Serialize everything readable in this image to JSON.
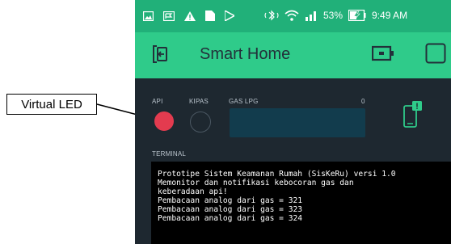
{
  "annotation": {
    "callout_label": "Virtual LED"
  },
  "status_bar": {
    "battery_percent": "53%",
    "time": "9:49 AM"
  },
  "header": {
    "title": "Smart Home"
  },
  "widgets": {
    "led_api": {
      "label": "API",
      "color": "#e33b4f",
      "state": "on"
    },
    "led_kipas": {
      "label": "KIPAS",
      "color": "#1e2830",
      "state": "off"
    },
    "gauge_gas": {
      "label": "GAS LPG",
      "value": "0",
      "color": "#123c4d"
    }
  },
  "terminal": {
    "label": "TERMINAL",
    "lines": [
      "Prototipe Sistem Keamanan Rumah (SisKeRu) versi 1.0",
      "Memonitor dan notifikasi kebocoran gas dan",
      "keberadaan api!",
      "Pembacaan analog dari gas = 321",
      "Pembacaan analog dari gas = 323",
      "Pembacaan analog dari gas = 324"
    ]
  },
  "colors": {
    "status_bar": "#21b079",
    "header": "#2fcb8a",
    "background": "#1e2830",
    "accent": "#2fcb8a"
  },
  "icons": [
    "image-icon",
    "flag-icon",
    "warning-icon",
    "file-icon",
    "play-store-icon",
    "bluetooth-icon",
    "wifi-icon",
    "signal-icon",
    "battery-charging-icon",
    "back-icon",
    "device-icon",
    "square-icon",
    "phone-notification-icon"
  ]
}
